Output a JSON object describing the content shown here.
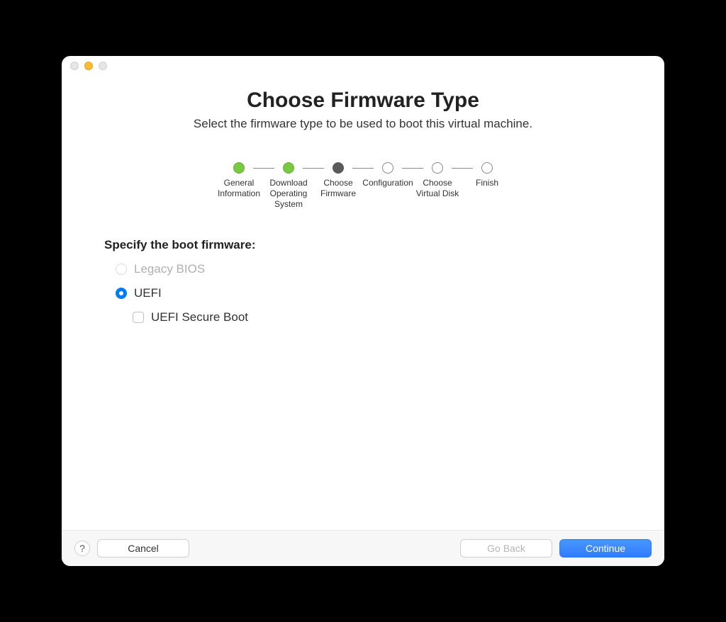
{
  "header": {
    "title": "Choose Firmware Type",
    "subtitle": "Select the firmware type to be used to boot this virtual machine."
  },
  "steps": [
    {
      "label": "General\nInformation",
      "state": "done"
    },
    {
      "label": "Download\nOperating\nSystem",
      "state": "done"
    },
    {
      "label": "Choose\nFirmware",
      "state": "current"
    },
    {
      "label": "Configuration",
      "state": "pending"
    },
    {
      "label": "Choose\nVirtual Disk",
      "state": "pending"
    },
    {
      "label": "Finish",
      "state": "pending"
    }
  ],
  "form": {
    "heading": "Specify the boot firmware:",
    "options": {
      "legacy_bios": {
        "label": "Legacy BIOS",
        "selected": false,
        "disabled": true
      },
      "uefi": {
        "label": "UEFI",
        "selected": true,
        "disabled": false
      },
      "secure_boot": {
        "label": "UEFI Secure Boot",
        "checked": false
      }
    }
  },
  "footer": {
    "help": "?",
    "cancel": "Cancel",
    "go_back": "Go Back",
    "continue": "Continue"
  }
}
